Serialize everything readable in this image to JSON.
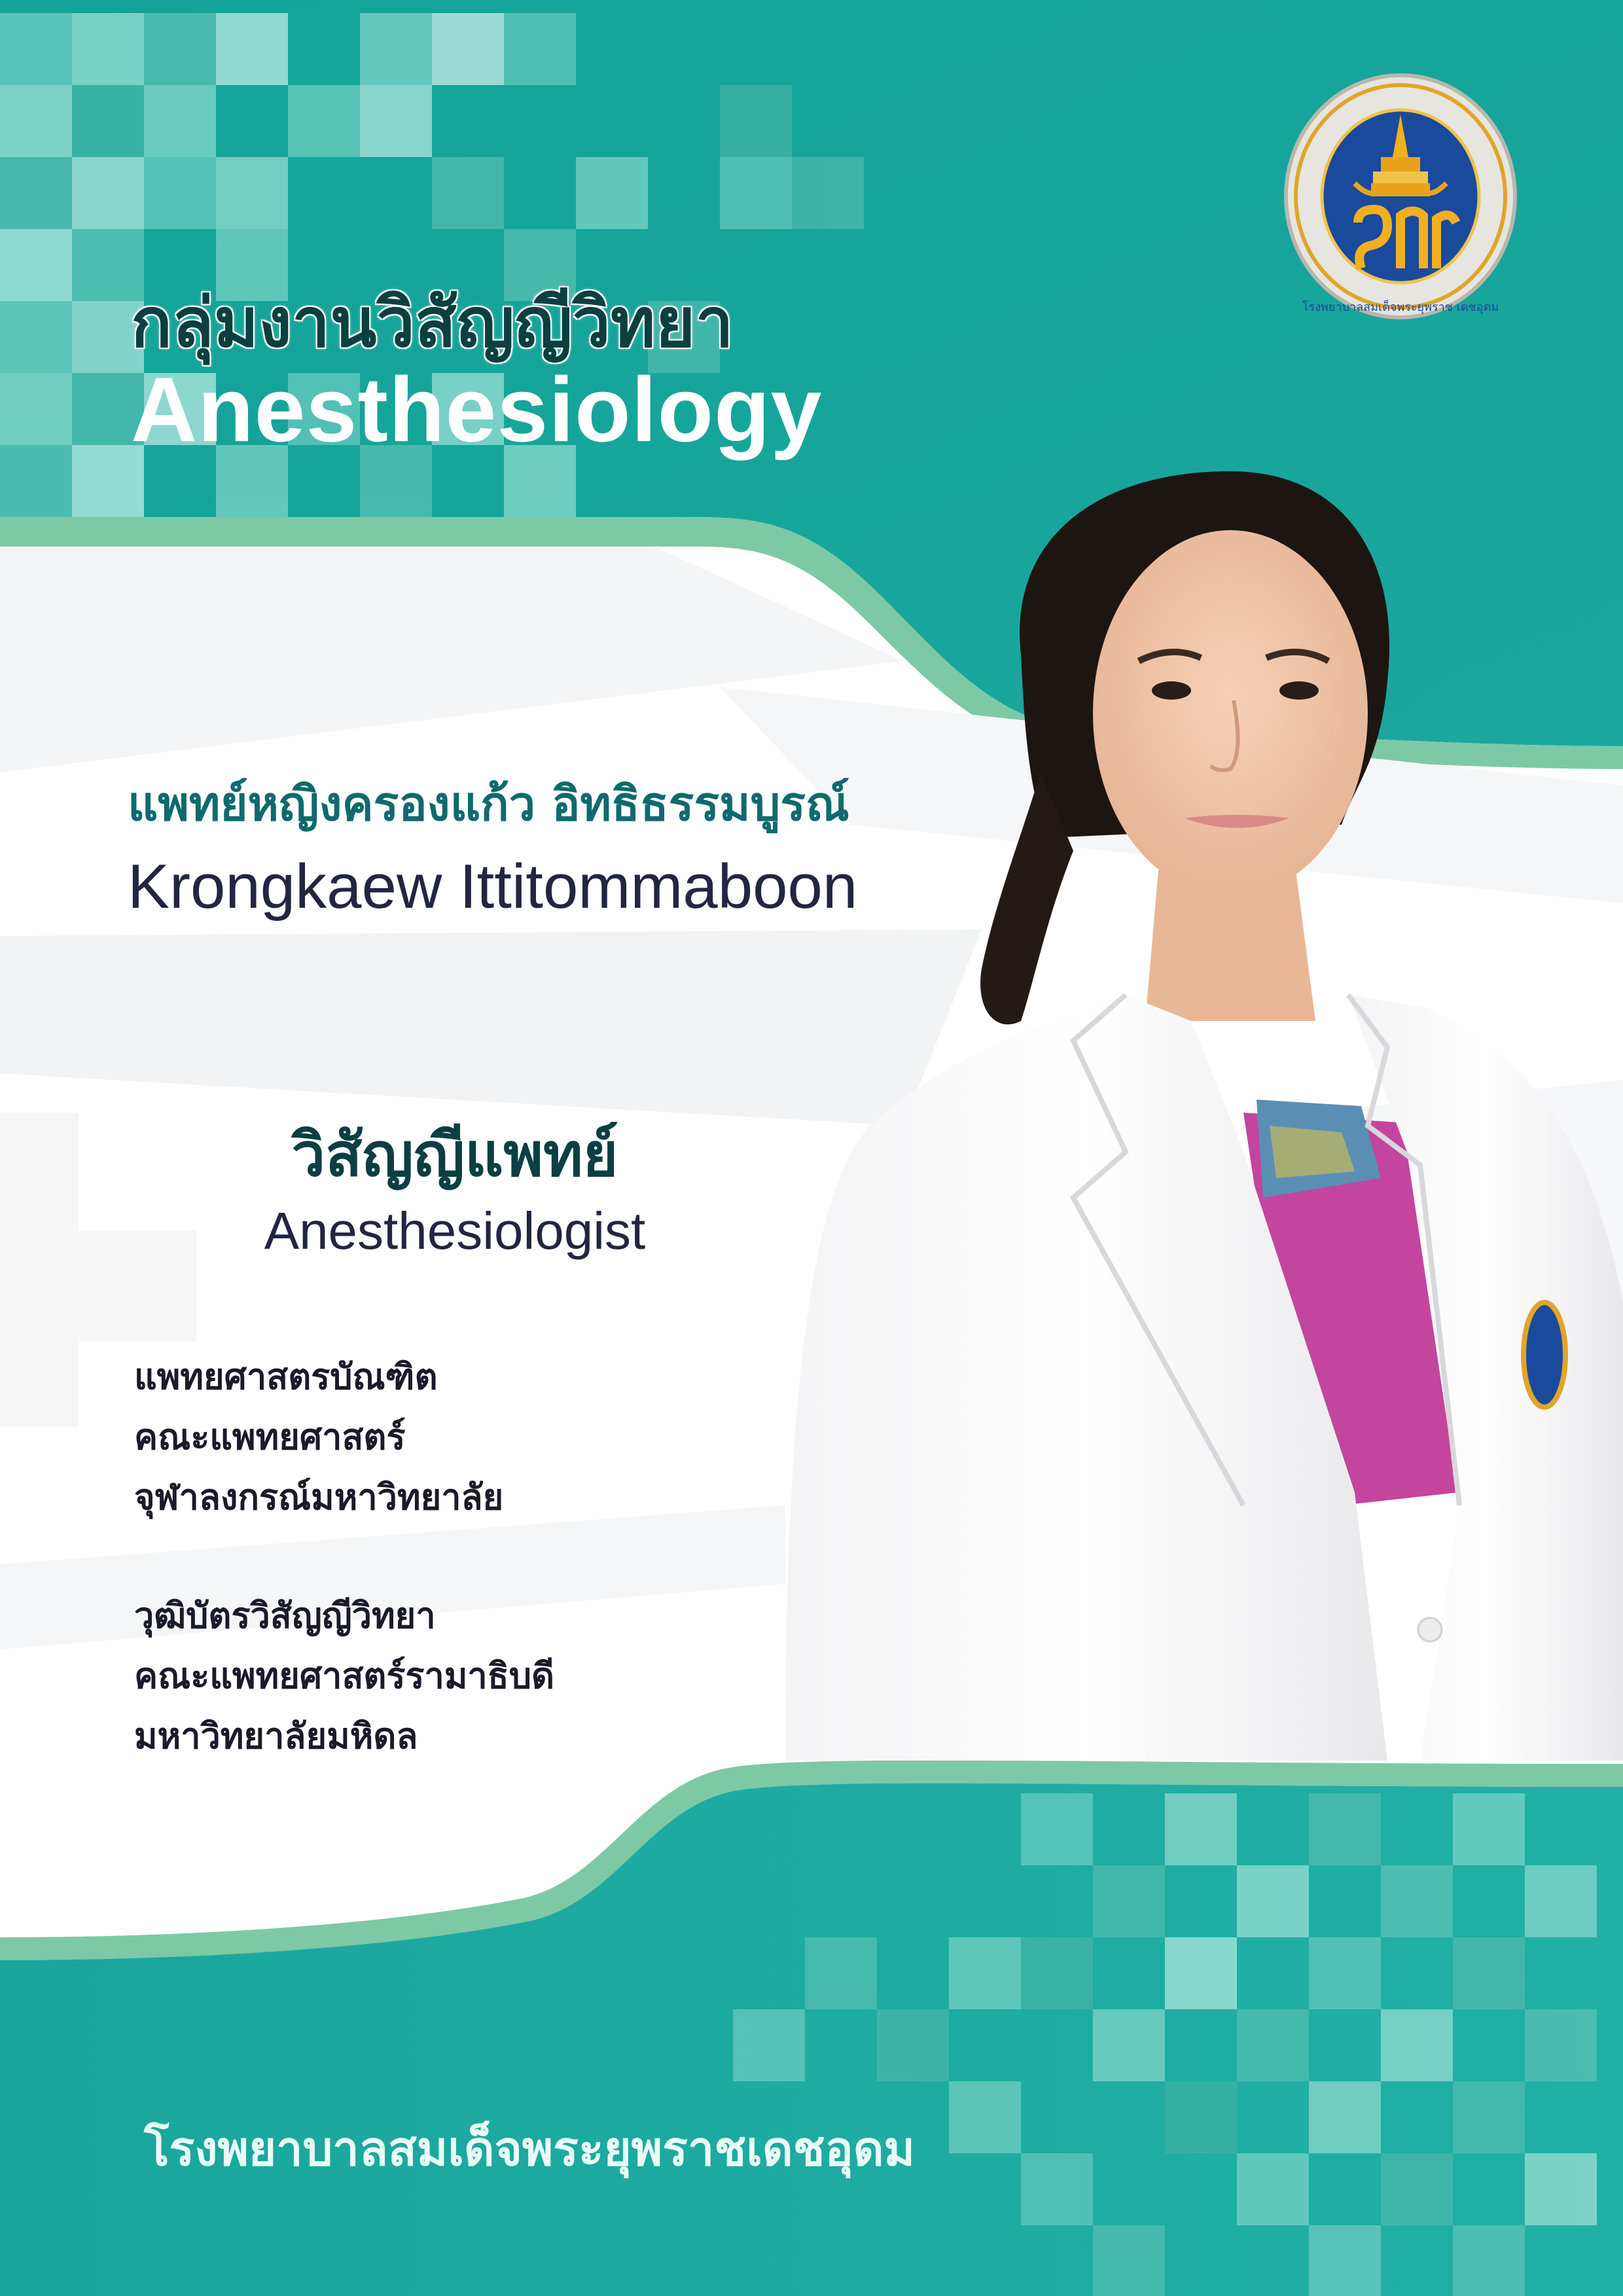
{
  "header": {
    "department_thai": "กลุ่มงานวิสัญญีวิทยา",
    "department_en": "Anesthesiology"
  },
  "logo": {
    "name": "hospital-seal",
    "ring_text": "โรงพยาบาลสมเด็จพระยุพราช เดชอุดม"
  },
  "doctor": {
    "name_thai": "แพทย์หญิงครองแก้ว อิทธิธรรมบูรณ์",
    "name_en": "Krongkaew Ittitommaboon",
    "position_thai": "วิสัญญีแพทย์",
    "position_en": "Anesthesiologist"
  },
  "education": [
    {
      "lines": [
        "แพทยศาสตรบัณฑิต",
        "คณะแพทยศาสตร์",
        "จุฬาลงกรณ์มหาวิทยาลัย"
      ]
    },
    {
      "lines": [
        "วุฒิบัตรวิสัญญีวิทยา",
        "คณะแพทยศาสตร์รามาธิบดี",
        "มหาวิทยาลัยมหิดล"
      ]
    }
  ],
  "footer": {
    "hospital_name": "โรงพยาบาลสมเด็จพระยุพราชเดชอุดม"
  },
  "colors": {
    "teal": "#19a79e",
    "teal_light": "#4cc2b7",
    "mint_band": "#7dc9a6",
    "heading_dark": "#0c3f42",
    "name_teal": "#0f6a6e",
    "seal_blue": "#1a4a9c",
    "seal_gold": "#e8a31a"
  }
}
